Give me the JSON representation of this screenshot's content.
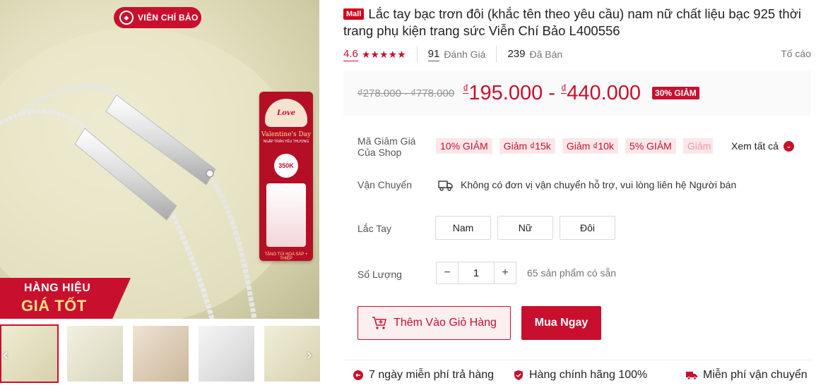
{
  "gallery": {
    "brand_badge": "VIỄN CHÍ BẢO",
    "promo_line1": "HÀNG HIỆU",
    "promo_line2": "GIÁ TỐT",
    "valentine": {
      "heart_text": "Love",
      "title": "Valentine's Day",
      "subtitle": "NGẬP TRÀN YÊU THƯƠNG",
      "price": "350K",
      "footer": "TẶNG TÚI HOA SÁP + THIỆP"
    },
    "thumbnails": 5,
    "active_thumbnail": 1
  },
  "product": {
    "mall_badge": "Mall",
    "title": "Lắc tay bạc trơn đôi (khắc tên theo yêu cầu) nam nữ chất liệu bạc 925 thời trang phụ kiện trang sức Viễn Chí Bảo L400556",
    "rating": "4.6",
    "rating_stars": 4.6,
    "stars": "★★★★★",
    "reviews_count": "91",
    "reviews_label": "Đánh Giá",
    "sold_count": "239",
    "sold_label": "Đã Bán",
    "report_label": "Tố cáo"
  },
  "price": {
    "original": "₫278.000 - ₫778.000",
    "currency_symbol": "₫",
    "min": "195.000",
    "separator": " - ",
    "max": "440.000",
    "discount_badge": "30% GIẢM"
  },
  "vouchers": {
    "label": "Mã Giảm Giá Của Shop",
    "items": [
      "10% GIẢM",
      "Giảm ₫15k",
      "Giảm ₫10k",
      "5% GIẢM",
      "Giảm ₫"
    ],
    "see_all": "Xem tất cả"
  },
  "shipping": {
    "label": "Vận Chuyển",
    "text": "Không có đơn vị vận chuyển hỗ trợ, vui lòng liên hệ Người bán"
  },
  "variant": {
    "label": "Lắc Tay",
    "options": [
      "Nam",
      "Nữ",
      "Đôi"
    ]
  },
  "quantity": {
    "label": "Số Lượng",
    "minus": "−",
    "value": "1",
    "plus": "+",
    "available": "65 sản phẩm có sẵn"
  },
  "actions": {
    "add_to_cart": "Thêm Vào Giỏ Hàng",
    "buy_now": "Mua Ngay"
  },
  "guarantees": {
    "return": "7 ngày miễn phí trả hàng",
    "authentic": "Hàng chính hãng 100%",
    "shipping": "Miễn phí vận chuyển"
  },
  "colors": {
    "accent": "#c8102e",
    "voucher_bg": "#fbe7ea",
    "price_bg": "#fafafa"
  }
}
